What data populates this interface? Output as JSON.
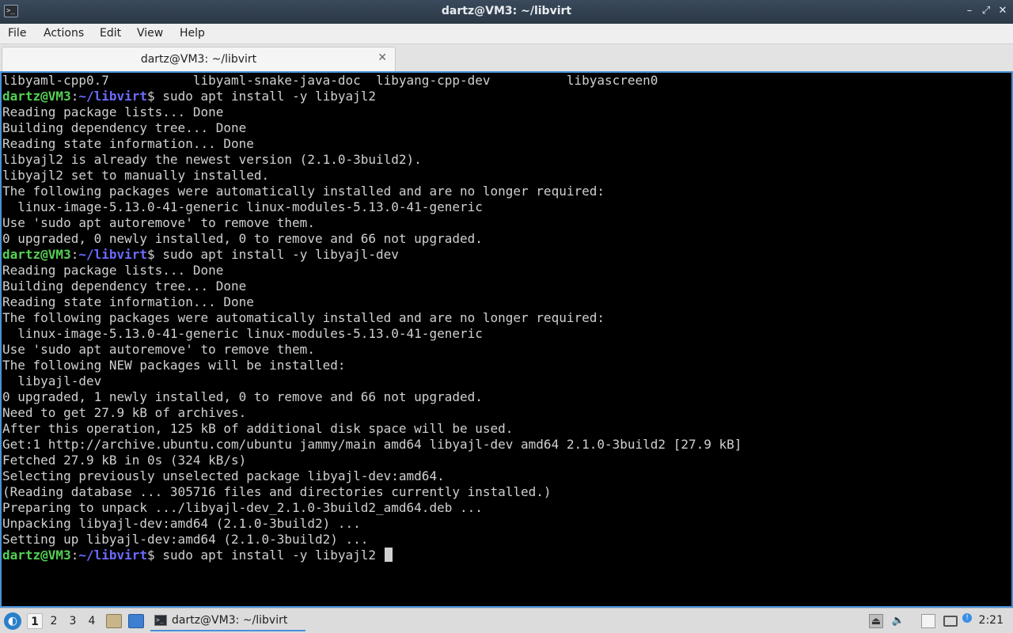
{
  "window": {
    "title": "dartz@VM3: ~/libvirt",
    "minimize": "–",
    "maximize": "⤢",
    "close": "✕"
  },
  "menu": {
    "file": "File",
    "actions": "Actions",
    "edit": "Edit",
    "view": "View",
    "help": "Help"
  },
  "tab": {
    "label": "dartz@VM3: ~/libvirt",
    "close": "✕"
  },
  "terminal": {
    "prompt_user": "dartz@VM3",
    "prompt_path": "~/libvirt",
    "lines": [
      {
        "type": "text",
        "text": "libyaml-cpp0.7           libyaml-snake-java-doc  libyang-cpp-dev          libyascreen0"
      },
      {
        "type": "prompt",
        "text": "sudo apt install -y libyajl2"
      },
      {
        "type": "text",
        "text": "Reading package lists... Done"
      },
      {
        "type": "text",
        "text": "Building dependency tree... Done"
      },
      {
        "type": "text",
        "text": "Reading state information... Done"
      },
      {
        "type": "text",
        "text": "libyajl2 is already the newest version (2.1.0-3build2)."
      },
      {
        "type": "text",
        "text": "libyajl2 set to manually installed."
      },
      {
        "type": "text",
        "text": "The following packages were automatically installed and are no longer required:"
      },
      {
        "type": "text",
        "text": "  linux-image-5.13.0-41-generic linux-modules-5.13.0-41-generic"
      },
      {
        "type": "text",
        "text": "Use 'sudo apt autoremove' to remove them."
      },
      {
        "type": "text",
        "text": "0 upgraded, 0 newly installed, 0 to remove and 66 not upgraded."
      },
      {
        "type": "prompt",
        "text": "sudo apt install -y libyajl-dev"
      },
      {
        "type": "text",
        "text": "Reading package lists... Done"
      },
      {
        "type": "text",
        "text": "Building dependency tree... Done"
      },
      {
        "type": "text",
        "text": "Reading state information... Done"
      },
      {
        "type": "text",
        "text": "The following packages were automatically installed and are no longer required:"
      },
      {
        "type": "text",
        "text": "  linux-image-5.13.0-41-generic linux-modules-5.13.0-41-generic"
      },
      {
        "type": "text",
        "text": "Use 'sudo apt autoremove' to remove them."
      },
      {
        "type": "text",
        "text": "The following NEW packages will be installed:"
      },
      {
        "type": "text",
        "text": "  libyajl-dev"
      },
      {
        "type": "text",
        "text": "0 upgraded, 1 newly installed, 0 to remove and 66 not upgraded."
      },
      {
        "type": "text",
        "text": "Need to get 27.9 kB of archives."
      },
      {
        "type": "text",
        "text": "After this operation, 125 kB of additional disk space will be used."
      },
      {
        "type": "text",
        "text": "Get:1 http://archive.ubuntu.com/ubuntu jammy/main amd64 libyajl-dev amd64 2.1.0-3build2 [27.9 kB]"
      },
      {
        "type": "text",
        "text": "Fetched 27.9 kB in 0s (324 kB/s)"
      },
      {
        "type": "text",
        "text": "Selecting previously unselected package libyajl-dev:amd64."
      },
      {
        "type": "text",
        "text": "(Reading database ... 305716 files and directories currently installed.)"
      },
      {
        "type": "text",
        "text": "Preparing to unpack .../libyajl-dev_2.1.0-3build2_amd64.deb ..."
      },
      {
        "type": "text",
        "text": "Unpacking libyajl-dev:amd64 (2.1.0-3build2) ..."
      },
      {
        "type": "text",
        "text": "Setting up libyajl-dev:amd64 (2.1.0-3build2) ..."
      },
      {
        "type": "prompt",
        "text": "sudo apt install -y libyajl2 ",
        "cursor": true
      }
    ]
  },
  "taskbar": {
    "workspaces": [
      "1",
      "2",
      "3",
      "4"
    ],
    "active_workspace": "1",
    "task_label": "dartz@VM3: ~/libvirt",
    "clock": "2:21",
    "icons": {
      "start": "lubuntu-start-icon",
      "files": "file-manager-icon",
      "desktop": "show-desktop-icon",
      "drive": "removable-drive-icon",
      "volume": "volume-icon",
      "clipboard": "clipboard-icon",
      "network": "network-icon",
      "updates": "update-notifier-icon"
    },
    "colors": {
      "accent": "#4a90d9"
    }
  }
}
